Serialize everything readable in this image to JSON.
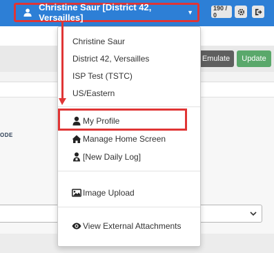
{
  "topbar": {
    "user_label": "Christine Saur [District 42, Versailles]",
    "counter": "190 / 0",
    "accent_color": "#2d7fd6"
  },
  "toolbar": {
    "emulate_label": "Emulate",
    "update_label": "Update"
  },
  "page": {
    "section_fragment": "ODE"
  },
  "dropdown": {
    "info": [
      "Christine Saur",
      "District 42, Versailles",
      "ISP Test (TSTC)",
      "US/Eastern"
    ],
    "items": [
      {
        "label": "My Profile",
        "icon": "user-icon"
      },
      {
        "label": "Manage Home Screen",
        "icon": "home-icon"
      },
      {
        "label": "[New Daily Log]",
        "icon": "user-badge-icon"
      },
      {
        "label": "Image Upload",
        "icon": "image-icon"
      },
      {
        "label": "View External Attachments",
        "icon": "eye-icon"
      }
    ]
  },
  "annotation": {
    "color": "#e03535"
  }
}
